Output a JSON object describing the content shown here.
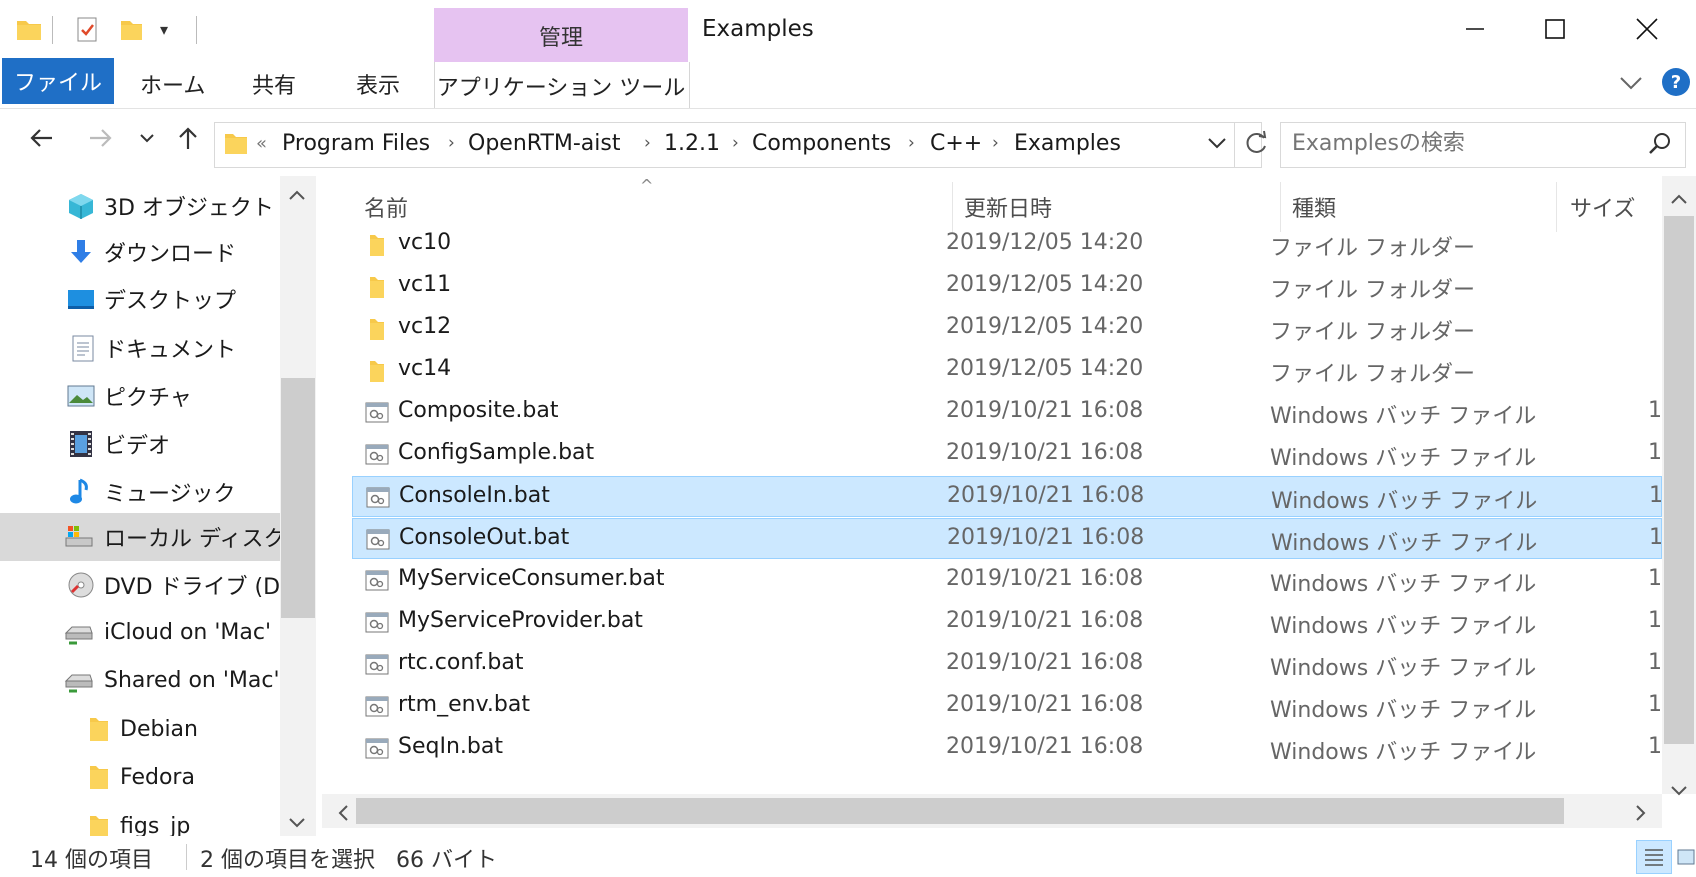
{
  "window": {
    "title": "Examples",
    "contextual_group": "管理",
    "minimize_icon": "minimize-icon",
    "maximize_icon": "maximize-icon",
    "close_icon": "close-icon"
  },
  "ribbon": {
    "tabs": [
      {
        "label": "ファイル",
        "active": true
      },
      {
        "label": "ホーム"
      },
      {
        "label": "共有"
      },
      {
        "label": "表示"
      },
      {
        "label": "アプリケーション ツール"
      }
    ]
  },
  "address": {
    "overflow": "«",
    "crumbs": [
      "Program Files",
      "OpenRTM-aist",
      "1.2.1",
      "Components",
      "C++",
      "Examples"
    ]
  },
  "search": {
    "placeholder": "Examplesの検索"
  },
  "nav": {
    "items": [
      {
        "label": "3D オブジェクト",
        "icon": "3d-objects-icon"
      },
      {
        "label": "ダウンロード",
        "icon": "download-icon"
      },
      {
        "label": "デスクトップ",
        "icon": "desktop-icon"
      },
      {
        "label": "ドキュメント",
        "icon": "documents-icon"
      },
      {
        "label": "ピクチャ",
        "icon": "pictures-icon"
      },
      {
        "label": "ビデオ",
        "icon": "videos-icon"
      },
      {
        "label": "ミュージック",
        "icon": "music-icon"
      },
      {
        "label": "ローカル ディスク (C:",
        "icon": "local-disk-icon",
        "selected": true
      },
      {
        "label": "DVD ドライブ (D:)",
        "icon": "dvd-drive-icon"
      },
      {
        "label": "iCloud on 'Mac'",
        "icon": "network-drive-icon"
      },
      {
        "label": "Shared on 'Mac'",
        "icon": "network-drive-icon"
      },
      {
        "label": "Debian",
        "icon": "folder-icon"
      },
      {
        "label": "Fedora",
        "icon": "folder-icon"
      },
      {
        "label": "figs_jp",
        "icon": "folder-icon"
      }
    ]
  },
  "list": {
    "columns": [
      "名前",
      "更新日時",
      "種類",
      "サイズ"
    ],
    "sort_indicator": "^",
    "rows": [
      {
        "name": "vc10",
        "date": "2019/12/05 14:20",
        "type": "ファイル フォルダー",
        "size": "",
        "kind": "folder"
      },
      {
        "name": "vc11",
        "date": "2019/12/05 14:20",
        "type": "ファイル フォルダー",
        "size": "",
        "kind": "folder"
      },
      {
        "name": "vc12",
        "date": "2019/12/05 14:20",
        "type": "ファイル フォルダー",
        "size": "",
        "kind": "folder"
      },
      {
        "name": "vc14",
        "date": "2019/12/05 14:20",
        "type": "ファイル フォルダー",
        "size": "",
        "kind": "folder"
      },
      {
        "name": "Composite.bat",
        "date": "2019/10/21 16:08",
        "type": "Windows バッチ ファイル",
        "size": "1",
        "kind": "bat"
      },
      {
        "name": "ConfigSample.bat",
        "date": "2019/10/21 16:08",
        "type": "Windows バッチ ファイル",
        "size": "1",
        "kind": "bat"
      },
      {
        "name": "ConsoleIn.bat",
        "date": "2019/10/21 16:08",
        "type": "Windows バッチ ファイル",
        "size": "1",
        "kind": "bat",
        "selected": true
      },
      {
        "name": "ConsoleOut.bat",
        "date": "2019/10/21 16:08",
        "type": "Windows バッチ ファイル",
        "size": "1",
        "kind": "bat",
        "selected": true
      },
      {
        "name": "MyServiceConsumer.bat",
        "date": "2019/10/21 16:08",
        "type": "Windows バッチ ファイル",
        "size": "1",
        "kind": "bat"
      },
      {
        "name": "MyServiceProvider.bat",
        "date": "2019/10/21 16:08",
        "type": "Windows バッチ ファイル",
        "size": "1",
        "kind": "bat"
      },
      {
        "name": "rtc.conf.bat",
        "date": "2019/10/21 16:08",
        "type": "Windows バッチ ファイル",
        "size": "1",
        "kind": "bat"
      },
      {
        "name": "rtm_env.bat",
        "date": "2019/10/21 16:08",
        "type": "Windows バッチ ファイル",
        "size": "1",
        "kind": "bat"
      },
      {
        "name": "SeqIn.bat",
        "date": "2019/10/21 16:08",
        "type": "Windows バッチ ファイル",
        "size": "1",
        "kind": "bat"
      }
    ]
  },
  "status": {
    "item_count": "14 個の項目",
    "selection": "2 個の項目を選択",
    "size": "66 バイト"
  },
  "colors": {
    "file_tab": "#1f6fc6",
    "contextual_tab": "#e6c3f1",
    "selection_bg": "#cce8ff",
    "selection_border": "#99d1ff",
    "folder": "#f7c94a",
    "help": "#1f6fc6"
  }
}
